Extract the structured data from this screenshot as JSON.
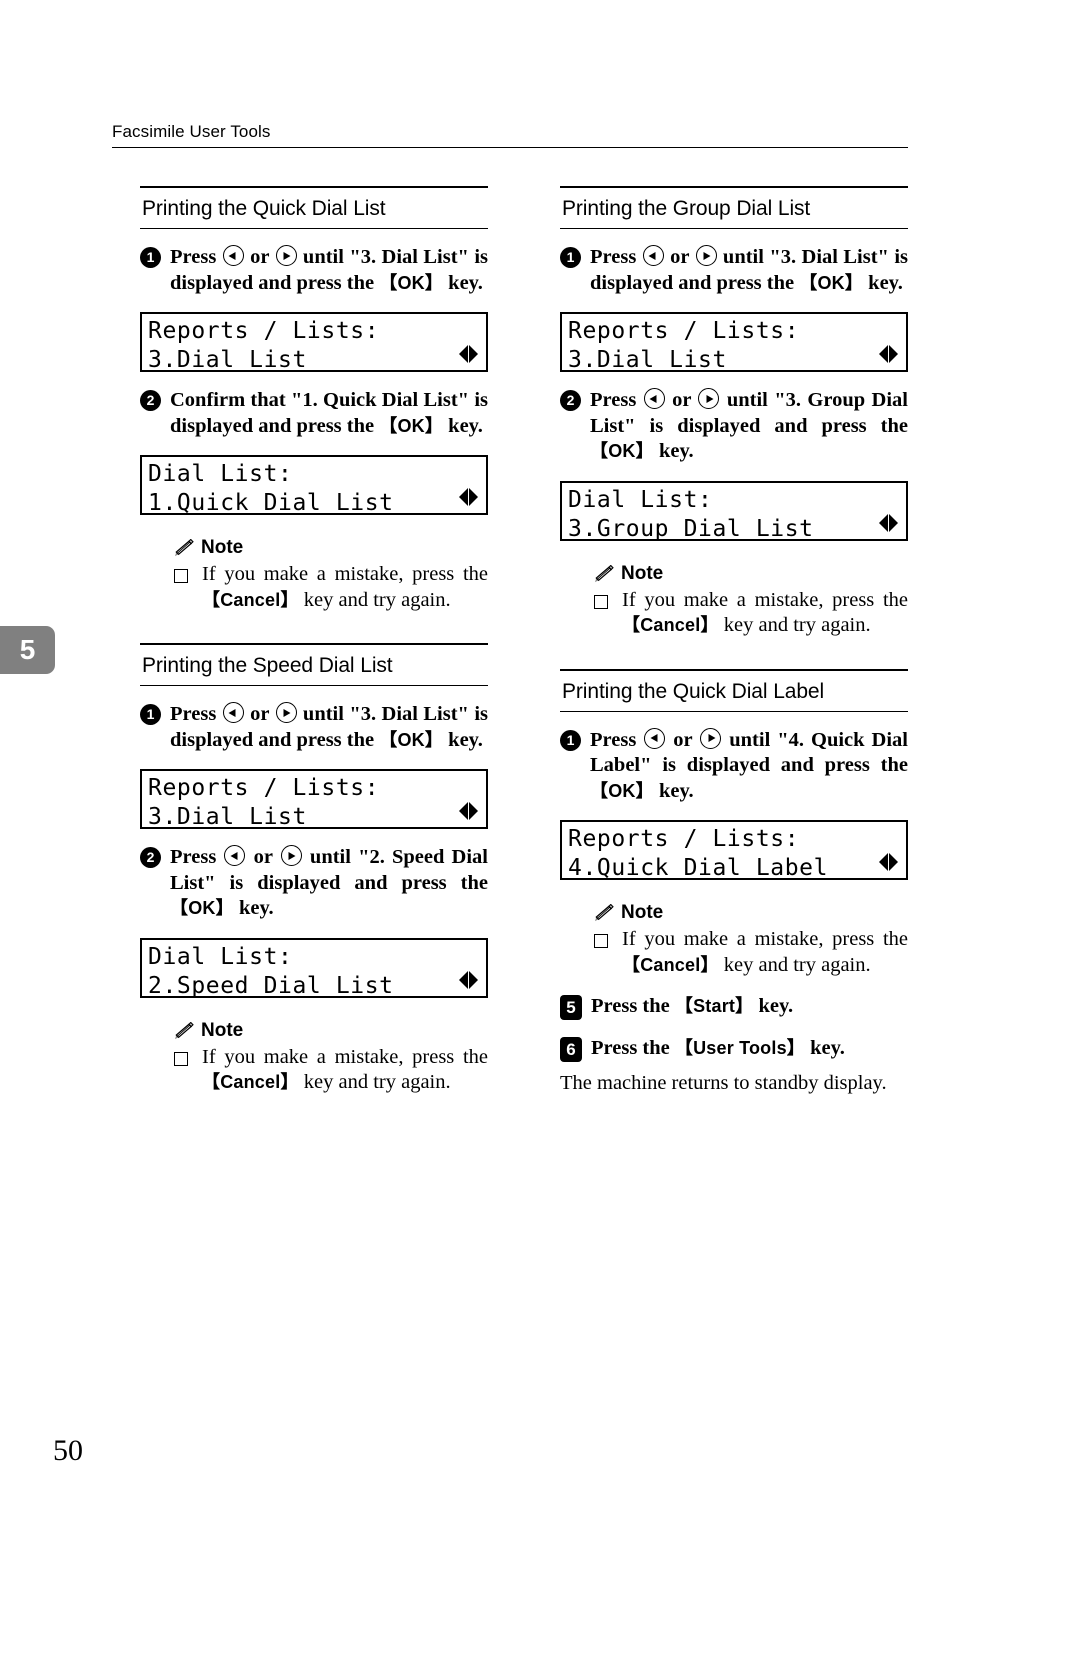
{
  "header": {
    "running_title": "Facsimile User Tools"
  },
  "chapter_tab": {
    "number": "5"
  },
  "page_number": "50",
  "keys": {
    "ok": "OK",
    "cancel": "Cancel",
    "start": "Start",
    "user_tools": "User Tools",
    "bracket_open": "【",
    "bracket_close": "】"
  },
  "note": {
    "label": "Note",
    "icon": "pencil-icon",
    "text_a": "If you make a mistake, press the ",
    "text_b": " key and try again."
  },
  "sections": {
    "quick_dial_list": {
      "title": "Printing the Quick Dial List",
      "step1": {
        "number": "1",
        "text_a": "Press ",
        "text_b": " or ",
        "text_c": " until \"3. Dial List\" is displayed and press the ",
        "text_d": " key."
      },
      "lcd1": {
        "line1": "Reports / Lists:",
        "line2": "3.Dial List",
        "arrows": "left-right-arrows"
      },
      "step2": {
        "number": "2",
        "text_a": "Confirm that \"1. Quick Dial List\" is displayed and press the ",
        "text_b": " key."
      },
      "lcd2": {
        "line1": "Dial List:",
        "line2": "1.Quick Dial List",
        "arrows": "left-right-arrows"
      }
    },
    "group_dial_list": {
      "title": "Printing the Group Dial List",
      "step1": {
        "number": "1",
        "text_a": "Press ",
        "text_b": " or ",
        "text_c": " until \"3. Dial List\" is displayed and press the ",
        "text_d": " key."
      },
      "lcd1": {
        "line1": "Reports / Lists:",
        "line2": "3.Dial List",
        "arrows": "left-right-arrows"
      },
      "step2": {
        "number": "2",
        "text_a": "Press ",
        "text_b": " or ",
        "text_c": " until \"3. Group Dial List\" is displayed and press the ",
        "text_d": " key."
      },
      "lcd2": {
        "line1": "Dial List:",
        "line2": "3.Group Dial List",
        "arrows": "left-right-arrows"
      }
    },
    "speed_dial_list": {
      "title": "Printing the Speed Dial List",
      "step1": {
        "number": "1",
        "text_a": "Press ",
        "text_b": " or ",
        "text_c": " until \"3. Dial List\" is displayed and press the ",
        "text_d": " key."
      },
      "lcd1": {
        "line1": "Reports / Lists:",
        "line2": "3.Dial List",
        "arrows": "left-right-arrows"
      },
      "step2": {
        "number": "2",
        "text_a": "Press ",
        "text_b": " or ",
        "text_c": " until \"2. Speed Dial List\" is displayed and press the ",
        "text_d": " key."
      },
      "lcd2": {
        "line1": "Dial List:",
        "line2": "2.Speed Dial List",
        "arrows": "left-right-arrows"
      }
    },
    "quick_dial_label": {
      "title": "Printing the Quick Dial Label",
      "step1": {
        "number": "1",
        "text_a": "Press ",
        "text_b": " or ",
        "text_c": " until \"4. Quick Dial Label\" is displayed and press the ",
        "text_d": " key."
      },
      "lcd1": {
        "line1": "Reports / Lists:",
        "line2": "4.Quick Dial Label",
        "arrows": "left-right-arrows"
      },
      "step5": {
        "number": "5",
        "text_a": "Press the ",
        "text_b": " key."
      },
      "step6": {
        "number": "6",
        "text_a": "Press the ",
        "text_b": " key."
      },
      "closing": "The machine returns to standby display."
    }
  }
}
